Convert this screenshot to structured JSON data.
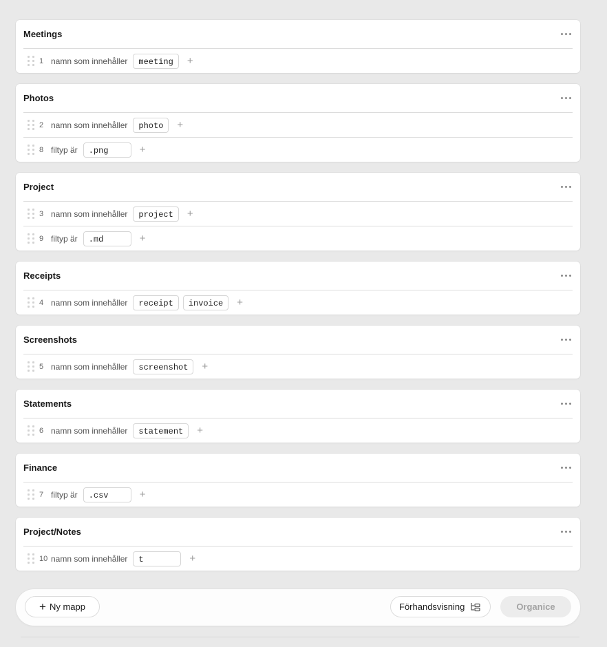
{
  "folders": [
    {
      "title": "Meetings",
      "rules": [
        {
          "num": "1",
          "label": "namn som innehåller",
          "values": [
            "meeting"
          ]
        }
      ]
    },
    {
      "title": "Photos",
      "rules": [
        {
          "num": "2",
          "label": "namn som innehåller",
          "values": [
            "photo"
          ]
        },
        {
          "num": "8",
          "label": "filtyp är",
          "values": [
            ".png"
          ]
        }
      ]
    },
    {
      "title": "Project",
      "rules": [
        {
          "num": "3",
          "label": "namn som innehåller",
          "values": [
            "project"
          ]
        },
        {
          "num": "9",
          "label": "filtyp är",
          "values": [
            ".md"
          ]
        }
      ]
    },
    {
      "title": "Receipts",
      "rules": [
        {
          "num": "4",
          "label": "namn som innehåller",
          "values": [
            "receipt",
            "invoice"
          ]
        }
      ]
    },
    {
      "title": "Screenshots",
      "rules": [
        {
          "num": "5",
          "label": "namn som innehåller",
          "values": [
            "screenshot"
          ]
        }
      ]
    },
    {
      "title": "Statements",
      "rules": [
        {
          "num": "6",
          "label": "namn som innehåller",
          "values": [
            "statement"
          ]
        }
      ]
    },
    {
      "title": "Finance",
      "rules": [
        {
          "num": "7",
          "label": "filtyp är",
          "values": [
            ".csv"
          ]
        }
      ]
    },
    {
      "title": "Project/Notes",
      "rules": [
        {
          "num": "10",
          "label": "namn som innehåller",
          "values": [
            "t"
          ]
        }
      ]
    }
  ],
  "icons": {
    "more": "more-horizontal-icon",
    "drag": "drag-handle-icon",
    "add": "plus-icon",
    "tree": "folder-tree-icon"
  },
  "toolbar": {
    "new_folder_label": "Ny mapp",
    "preview_label": "Förhandsvisning",
    "organize_label": "Organice"
  }
}
